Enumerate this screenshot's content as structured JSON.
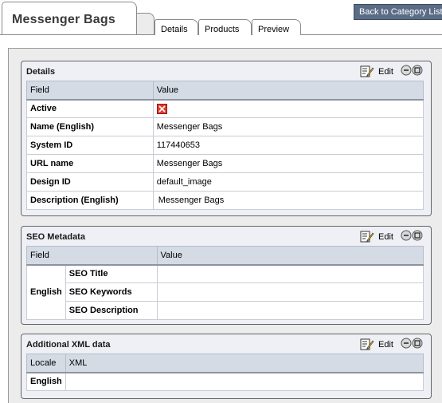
{
  "header": {
    "title": "Messenger Bags",
    "tabs": [
      "Details",
      "Products",
      "Preview"
    ],
    "back_button": "Back to Category List"
  },
  "panels": {
    "details": {
      "title": "Details",
      "edit_label": "Edit",
      "columns": [
        "Field",
        "Value"
      ],
      "rows": [
        {
          "field": "Active",
          "value": ""
        },
        {
          "field": "Name (English)",
          "value": "Messenger Bags"
        },
        {
          "field": "System ID",
          "value": "117440653"
        },
        {
          "field": "URL name",
          "value": "Messenger Bags"
        },
        {
          "field": "Design ID",
          "value": "default_image"
        },
        {
          "field": "Description (English)",
          "value": "Messenger Bags"
        }
      ]
    },
    "seo": {
      "title": "SEO Metadata",
      "edit_label": "Edit",
      "columns": [
        "Field",
        "Value"
      ],
      "locale": "English",
      "rows": [
        "SEO Title",
        "SEO Keywords",
        "SEO Description"
      ]
    },
    "xml": {
      "title": "Additional XML data",
      "edit_label": "Edit",
      "columns": [
        "Locale",
        "XML"
      ],
      "rows": [
        {
          "locale": "English",
          "xml": ""
        }
      ]
    }
  },
  "colors": {
    "back_button_bg": "#5b6d86",
    "header_cell_bg": "#d4dbe5",
    "panel_bg": "#eef0f6",
    "inactive_icon": "#e63b2e"
  }
}
